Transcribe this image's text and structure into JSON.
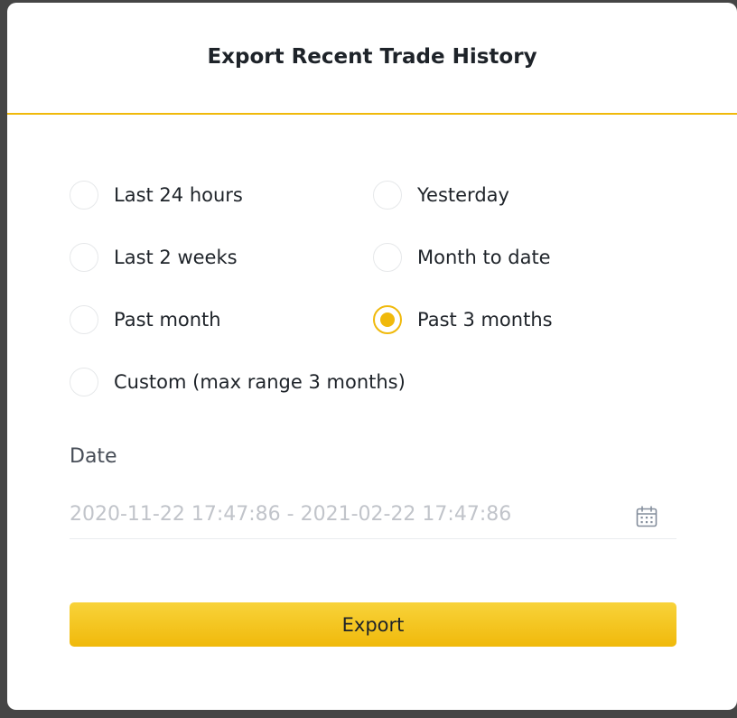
{
  "modal": {
    "title": "Export Recent Trade History"
  },
  "options": [
    {
      "label": "Last 24 hours",
      "checked": false
    },
    {
      "label": "Yesterday",
      "checked": false
    },
    {
      "label": "Last 2 weeks",
      "checked": false
    },
    {
      "label": "Month to date",
      "checked": false
    },
    {
      "label": "Past month",
      "checked": false
    },
    {
      "label": "Past 3 months",
      "checked": true
    },
    {
      "label": "Custom (max range 3 months)",
      "checked": false
    }
  ],
  "date": {
    "label": "Date",
    "value": "2020-11-22 17:47:86 - 2021-02-22 17:47:86",
    "icon": "calendar-icon"
  },
  "export_button": {
    "label": "Export"
  },
  "colors": {
    "accent": "#F0B90B",
    "text": "#1E2329",
    "muted_text": "#C1C4CA",
    "overlay": "#454545"
  }
}
